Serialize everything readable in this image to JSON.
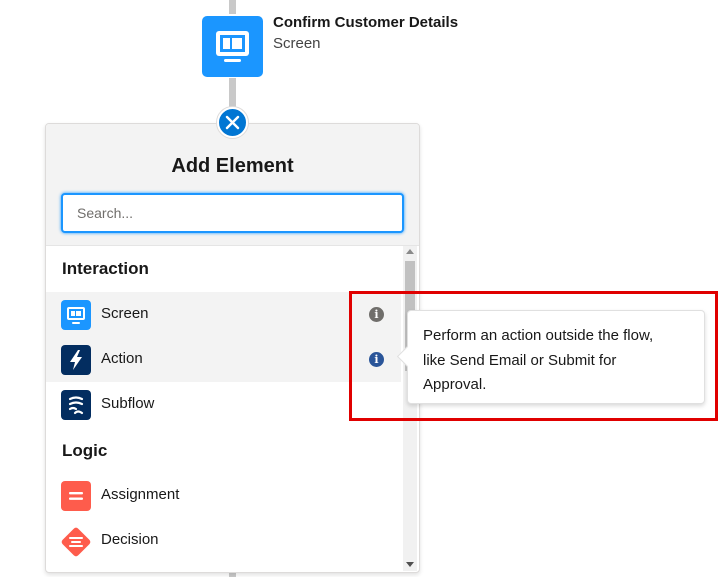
{
  "canvas": {
    "node": {
      "title": "Confirm Customer Details",
      "type_label": "Screen",
      "icon": "screen-icon",
      "color": "#1b96ff"
    },
    "close_icon": "close-icon"
  },
  "panel": {
    "title": "Add Element",
    "search": {
      "placeholder": "Search...",
      "value": ""
    },
    "sections": [
      {
        "label": "Interaction",
        "items": [
          {
            "label": "Screen",
            "icon": "screen-icon",
            "color": "#1b96ff",
            "info": true
          },
          {
            "label": "Action",
            "icon": "lightning-bolt-icon",
            "color": "#032d60",
            "info": true
          },
          {
            "label": "Subflow",
            "icon": "subflow-icon",
            "color": "#032d60",
            "info": false
          }
        ]
      },
      {
        "label": "Logic",
        "items": [
          {
            "label": "Assignment",
            "icon": "assignment-icon",
            "color": "#fe5c4c",
            "info": false
          },
          {
            "label": "Decision",
            "icon": "decision-icon",
            "color": "#fe5c4c",
            "info": false
          }
        ]
      }
    ]
  },
  "tooltip": {
    "lines": [
      "Perform an action outside the flow,",
      "like Send Email or Submit for",
      "Approval."
    ]
  },
  "colors": {
    "accent": "#0176d3",
    "highlight_border": "#e00000"
  }
}
